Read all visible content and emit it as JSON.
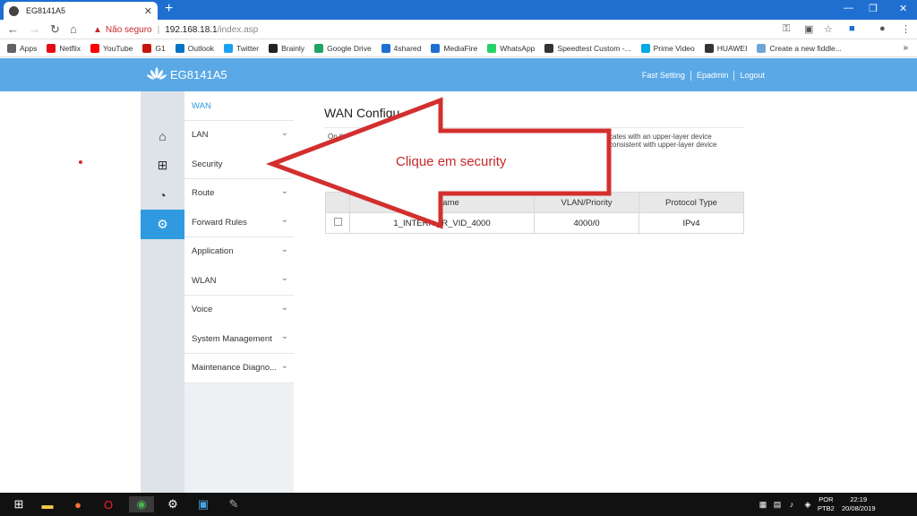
{
  "browser": {
    "tab_title": "EG8141A5",
    "tab_close": "✕",
    "new_tab": "+",
    "address": {
      "security_label": "Não seguro",
      "url_host": "192.168.18.1",
      "url_path": "/index.asp"
    },
    "bookmarks": [
      {
        "label": "Apps",
        "color": "#5f6368"
      },
      {
        "label": "Netflix",
        "color": "#e50914"
      },
      {
        "label": "YouTube",
        "color": "#ff0000"
      },
      {
        "label": "G1",
        "color": "#c4170c"
      },
      {
        "label": "Outlook",
        "color": "#0072c6"
      },
      {
        "label": "Twitter",
        "color": "#1da1f2"
      },
      {
        "label": "Brainly",
        "color": "#222222"
      },
      {
        "label": "Google Drive",
        "color": "#1fa463"
      },
      {
        "label": "4shared",
        "color": "#1e6fd0"
      },
      {
        "label": "MediaFire",
        "color": "#1e6fd0"
      },
      {
        "label": "WhatsApp",
        "color": "#25d366"
      },
      {
        "label": "Speedtest Custom -...",
        "color": "#333333"
      },
      {
        "label": "Prime Video",
        "color": "#00a8e1"
      },
      {
        "label": "HUAWEI",
        "color": "#333333"
      },
      {
        "label": "Create a new fiddle...",
        "color": "#6da7d8"
      }
    ],
    "more_bookmarks": "»"
  },
  "router": {
    "brand": "EG8141A5",
    "header_links": [
      "Fast Setting",
      "Epadmin",
      "Logout"
    ],
    "menu": [
      {
        "label": "WAN",
        "chevron": false,
        "head": true
      },
      {
        "label": "LAN",
        "chevron": true
      },
      {
        "label": "Security",
        "chevron": false
      },
      {
        "label": "Route",
        "chevron": true
      },
      {
        "label": "Forward Rules",
        "chevron": true
      },
      {
        "label": "Application",
        "chevron": true
      },
      {
        "label": "WLAN",
        "chevron": true
      },
      {
        "label": "Voice",
        "chevron": true
      },
      {
        "label": "System Management",
        "chevron": true
      },
      {
        "label": "Maintenance Diagno...",
        "chevron": true
      }
    ],
    "page_title": "WAN Configu",
    "desc_left": "On th",
    "desc_right_1": "cates with an upper-layer device",
    "desc_right_2": "consistent with upper-layer device",
    "table": {
      "headers": [
        "",
        "on Name",
        "VLAN/Priority",
        "Protocol Type"
      ],
      "rows": [
        [
          "",
          "1_INTERN   _R_VID_4000",
          "4000/0",
          "IPv4"
        ]
      ]
    }
  },
  "annotation": {
    "text": "Clique em security",
    "color": "#c62828"
  },
  "taskbar": {
    "lang": "POR",
    "layout": "PTB2",
    "time": "22:19",
    "date": "20/08/2019"
  }
}
